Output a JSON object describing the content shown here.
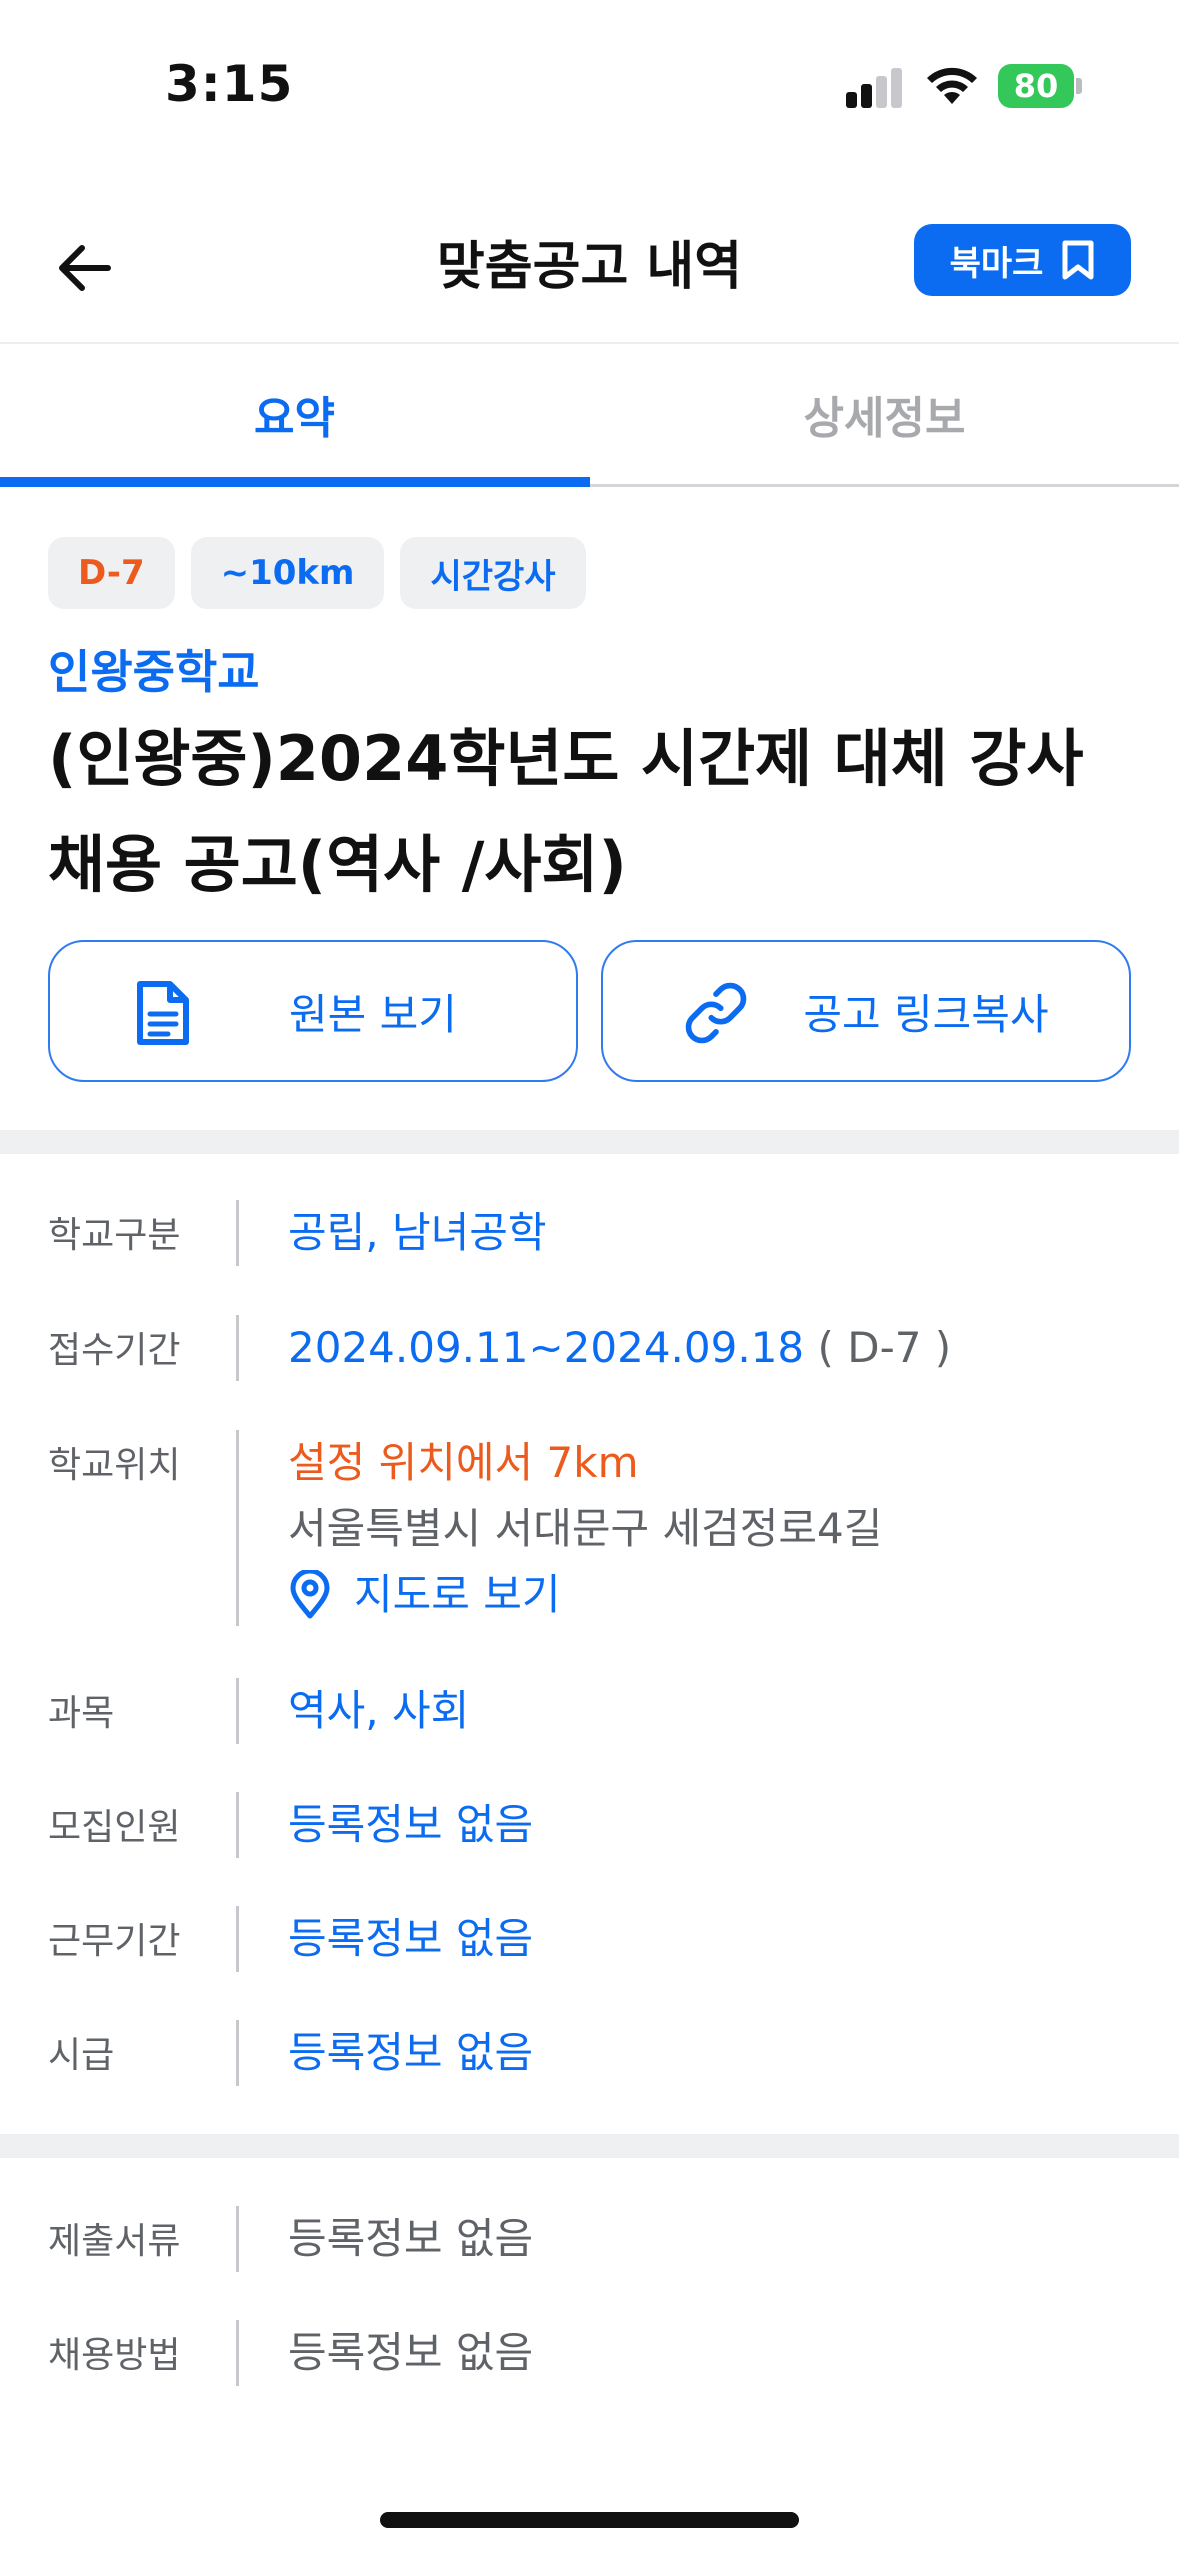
{
  "status_bar": {
    "time": "3:15",
    "battery": "80"
  },
  "header": {
    "title": "맞춤공고 내역",
    "bookmark_label": "북마크"
  },
  "tabs": [
    {
      "label": "요약",
      "active": true
    },
    {
      "label": "상세정보",
      "active": false
    }
  ],
  "badges": [
    {
      "label": "D-7"
    },
    {
      "label": "~10km"
    },
    {
      "label": "시간강사"
    }
  ],
  "school_name": "인왕중학교",
  "post_title": "(인왕중)2024학년도 시간제 대체 강사 채용 공고(역사 /사회)",
  "actions": {
    "view_original": "원본 보기",
    "copy_link": "공고 링크복사"
  },
  "info": {
    "school_type": {
      "label": "학교구분",
      "value": "공립, 남녀공학"
    },
    "period": {
      "label": "접수기간",
      "value": "2024.09.11~2024.09.18",
      "dday": "( D-7 )"
    },
    "location": {
      "label": "학교위치",
      "distance": "설정 위치에서 7km",
      "address": "서울특별시 서대문구 세검정로4길",
      "map_link": "지도로 보기"
    },
    "subject": {
      "label": "과목",
      "value": "역사, 사회"
    },
    "headcount": {
      "label": "모집인원",
      "value": "등록정보 없음"
    },
    "work_period": {
      "label": "근무기간",
      "value": "등록정보 없음"
    },
    "hourly_wage": {
      "label": "시급",
      "value": "등록정보 없음"
    }
  },
  "extra": {
    "documents": {
      "label": "제출서류",
      "value": "등록정보 없음"
    },
    "method": {
      "label": "채용방법",
      "value": "등록정보 없음"
    }
  },
  "colors": {
    "accent": "#0b6cf2",
    "warning": "#ec5b1d",
    "battery": "#34c759"
  }
}
